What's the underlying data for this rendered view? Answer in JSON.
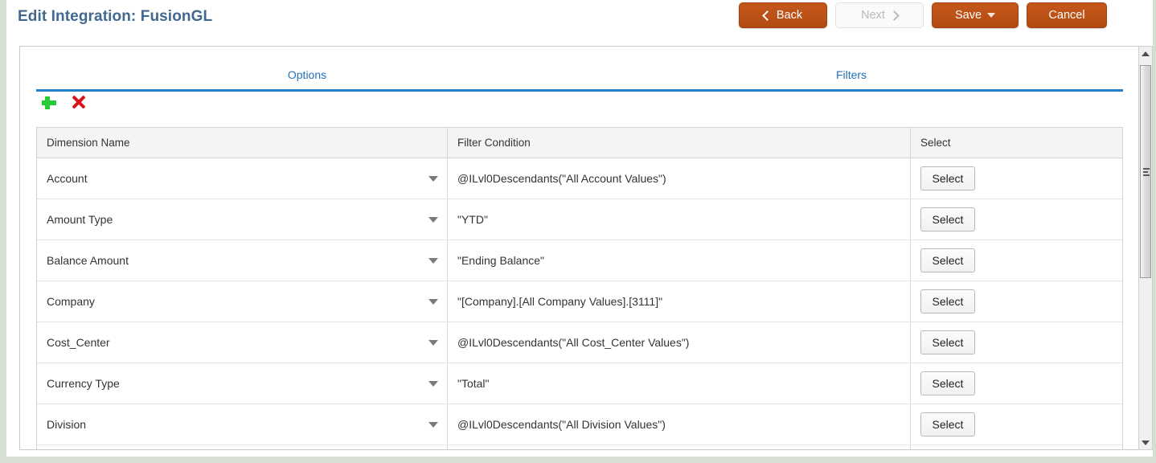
{
  "header": {
    "title": "Edit Integration: FusionGL",
    "title_color": "#41688f",
    "buttons": [
      {
        "name": "back",
        "label": "Back",
        "style": "primary",
        "icon": "chevron-left-icon",
        "icon_side": "left"
      },
      {
        "name": "next",
        "label": "Next",
        "style": "disabled",
        "icon": "chevron-right-icon",
        "icon_side": "right"
      },
      {
        "name": "save",
        "label": "Save",
        "style": "primary",
        "icon": "caret-down-icon",
        "icon_side": "right"
      },
      {
        "name": "cancel",
        "label": "Cancel",
        "style": "primary",
        "icon": "",
        "icon_side": ""
      }
    ],
    "accent_color": "#bb5016"
  },
  "tabs": {
    "items": [
      {
        "label": "Options",
        "active": false
      },
      {
        "label": "Filters",
        "active": true
      }
    ],
    "underline_color": "#1f80d0",
    "link_color": "#2471b8"
  },
  "toolbar": {
    "add_icon": "plus-icon",
    "add_color": "#25cc34",
    "delete_icon": "x-icon",
    "delete_color": "#d9141a"
  },
  "grid": {
    "columns": [
      "Dimension Name",
      "Filter Condition",
      "Select"
    ],
    "select_button_label": "Select",
    "rows": [
      {
        "dimension": "Account",
        "condition": "@ILvl0Descendants(\"All Account Values\")",
        "select": "Select"
      },
      {
        "dimension": "Amount Type",
        "condition": "\"YTD\"",
        "select": "Select"
      },
      {
        "dimension": "Balance Amount",
        "condition": "\"Ending Balance\"",
        "select": "Select"
      },
      {
        "dimension": "Company",
        "condition": "\"[Company].[All Company Values].[3111]\"",
        "select": "Select"
      },
      {
        "dimension": "Cost_Center",
        "condition": "@ILvl0Descendants(\"All Cost_Center Values\")",
        "select": "Select"
      },
      {
        "dimension": "Currency Type",
        "condition": "\"Total\"",
        "select": "Select"
      },
      {
        "dimension": "Division",
        "condition": "@ILvl0Descendants(\"All Division Values\")",
        "select": "Select"
      }
    ]
  },
  "scrollbar": {
    "up_icon": "arrow-up-icon",
    "down_icon": "arrow-down-icon",
    "thumb_icon": "scrollbar-thumb"
  }
}
